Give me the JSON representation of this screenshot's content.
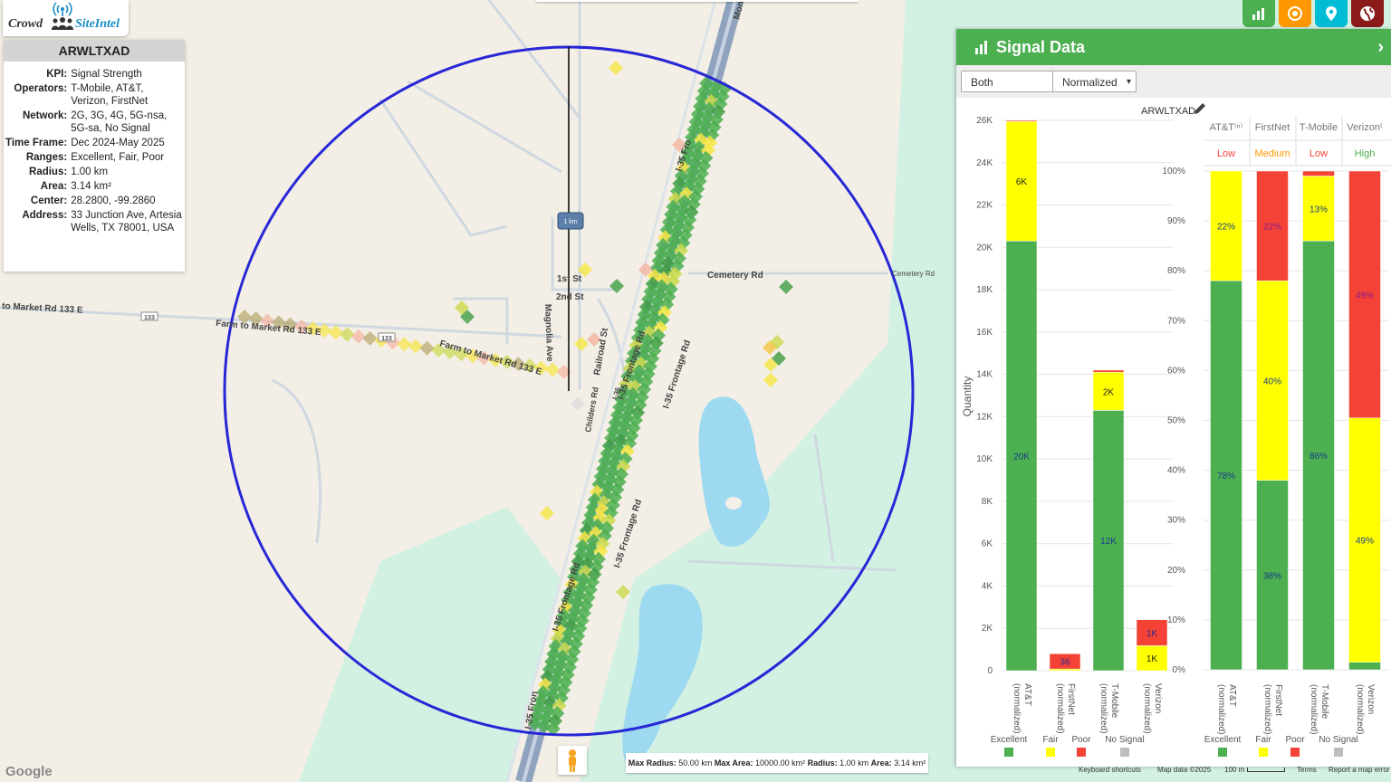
{
  "app": {
    "brand_left": "Crowd",
    "brand_right": "SiteIntel"
  },
  "info": {
    "title": "ARWLTXAD",
    "rows": [
      {
        "k": "KPI:",
        "v": "Signal Strength"
      },
      {
        "k": "Operators:",
        "v": "T-Mobile, AT&T, Verizon, FirstNet"
      },
      {
        "k": "Network:",
        "v": "2G, 3G, 4G, 5G-nsa, 5G-sa, No Signal"
      },
      {
        "k": "Time Frame:",
        "v": "Dec 2024-May 2025"
      },
      {
        "k": "Ranges:",
        "v": "Excellent, Fair, Poor"
      },
      {
        "k": "Radius:",
        "v": "1.00 km"
      },
      {
        "k": "Area:",
        "v": "3.14 km²"
      },
      {
        "k": "Center:",
        "v": "28.2800, -99.2860"
      },
      {
        "k": "Address:",
        "v": "33 Junction Ave, Artesia Wells, TX 78001, USA"
      }
    ]
  },
  "toolbar": {
    "buttons": [
      {
        "name": "chart-icon",
        "color": "#4caf50"
      },
      {
        "name": "target-icon",
        "color": "#ff9800"
      },
      {
        "name": "pin-icon",
        "color": "#00bcd4"
      },
      {
        "name": "globe-icon",
        "color": "#8b1a1a"
      }
    ]
  },
  "map": {
    "scale_label": "1 km",
    "roads": {
      "fm133_left": "to Market Rd 133 E",
      "fm133_mid": "Farm to Market Rd 133 E",
      "fm133_right": "Farm to Market Rd 133 E",
      "shield1": "133",
      "shield2": "133",
      "magnolia": "Magnolia Ave",
      "first": "1st St",
      "second": "2nd St",
      "railroad": "Railroad St",
      "childers": "Childers Rd",
      "cemetery": "Cemetery Rd",
      "cemetery2": "Cemetery Rd",
      "frontage1": "I-35 Frontage Rd",
      "frontage2": "I-35 Frontage Rd",
      "frontage3": "I-35 Frontage Rd",
      "frontage4": "I-35 Frontage Rd",
      "frontage_top": "I-35 Fro",
      "frontage_bottom": "I-35 Fron",
      "mon": "Mon",
      "i35_short": "I-35"
    },
    "status": {
      "max_radius_label": "Max Radius:",
      "max_radius": "50.00 km",
      "max_area_label": "Max Area:",
      "max_area": "10000.00 km²",
      "radius_label": "Radius:",
      "radius": "1.00 km",
      "area_label": "Area:",
      "area": "3.14 km²"
    },
    "google": "Google",
    "attribution": {
      "shortcuts": "Keyboard shortcuts",
      "data": "Map data ©2025",
      "scale": "100 m",
      "terms": "Terms",
      "report": "Report a map error"
    }
  },
  "panel": {
    "title": "Signal Data",
    "filter_value": "Both",
    "mode_value": "Normalized",
    "chart_title": "ARWLTXAD"
  },
  "chart_data": [
    {
      "type": "bar",
      "stacked": true,
      "title": "ARWLTXAD",
      "ylabel": "Quantity",
      "ylim": [
        0,
        26000
      ],
      "yticks": [
        "0",
        "2K",
        "4K",
        "6K",
        "8K",
        "10K",
        "12K",
        "14K",
        "16K",
        "18K",
        "20K",
        "22K",
        "24K",
        "26K"
      ],
      "categories": [
        "AT&T (normalized)",
        "FirstNet (normalized)",
        "T-Mobile (normalized)",
        "Verizon (normalized)"
      ],
      "series": [
        {
          "name": "Excellent",
          "color": "#4caf50",
          "values": [
            20300,
            0,
            12300,
            0
          ],
          "labels": [
            "20K",
            "",
            "12K",
            ""
          ]
        },
        {
          "name": "Fair",
          "color": "#ffff00",
          "values": [
            5650,
            80,
            1800,
            1180
          ],
          "labels": [
            "6K",
            "",
            "2K",
            "1K"
          ]
        },
        {
          "name": "Poor",
          "color": "#f44336",
          "values": [
            50,
            720,
            100,
            1230
          ],
          "labels": [
            "",
            "36",
            "",
            "1K"
          ]
        },
        {
          "name": "No Signal",
          "color": "#bdbdbd",
          "values": [
            0,
            0,
            0,
            0
          ],
          "labels": [
            "",
            "",
            "",
            ""
          ]
        }
      ],
      "legend": "bottom",
      "grid": true
    },
    {
      "type": "bar",
      "stacked": true,
      "ylim": [
        0,
        100
      ],
      "yticks": [
        "0%",
        "10%",
        "20%",
        "30%",
        "40%",
        "50%",
        "60%",
        "70%",
        "80%",
        "90%",
        "100%"
      ],
      "categories": [
        "AT&T (normalized)",
        "FirstNet (normalized)",
        "T-Mobile (normalized)",
        "Verizon (normalized)"
      ],
      "table_headers": [
        "AT&T⁽ⁿ⁾",
        "FirstNet",
        "T-Mobile",
        "Verizon⁽"
      ],
      "ratings": [
        {
          "label": "Low",
          "color": "#f44336"
        },
        {
          "label": "Medium",
          "color": "#ff9800"
        },
        {
          "label": "Low",
          "color": "#f44336"
        },
        {
          "label": "High",
          "color": "#4caf50"
        }
      ],
      "series": [
        {
          "name": "Excellent",
          "color": "#4caf50",
          "values": [
            78,
            38,
            86,
            1.5
          ],
          "labels": [
            "78%",
            "38%",
            "86%",
            ""
          ]
        },
        {
          "name": "Fair",
          "color": "#ffff00",
          "values": [
            22,
            40,
            13,
            49
          ],
          "labels": [
            "22%",
            "40%",
            "13%",
            "49%"
          ]
        },
        {
          "name": "Poor",
          "color": "#f44336",
          "values": [
            0,
            22,
            1,
            49.5
          ],
          "labels": [
            "",
            "22%",
            "",
            "49%"
          ]
        },
        {
          "name": "No Signal",
          "color": "#bdbdbd",
          "values": [
            0,
            0,
            0,
            0
          ],
          "labels": [
            "",
            "",
            "",
            ""
          ]
        }
      ],
      "legend": "bottom",
      "grid": true
    }
  ]
}
